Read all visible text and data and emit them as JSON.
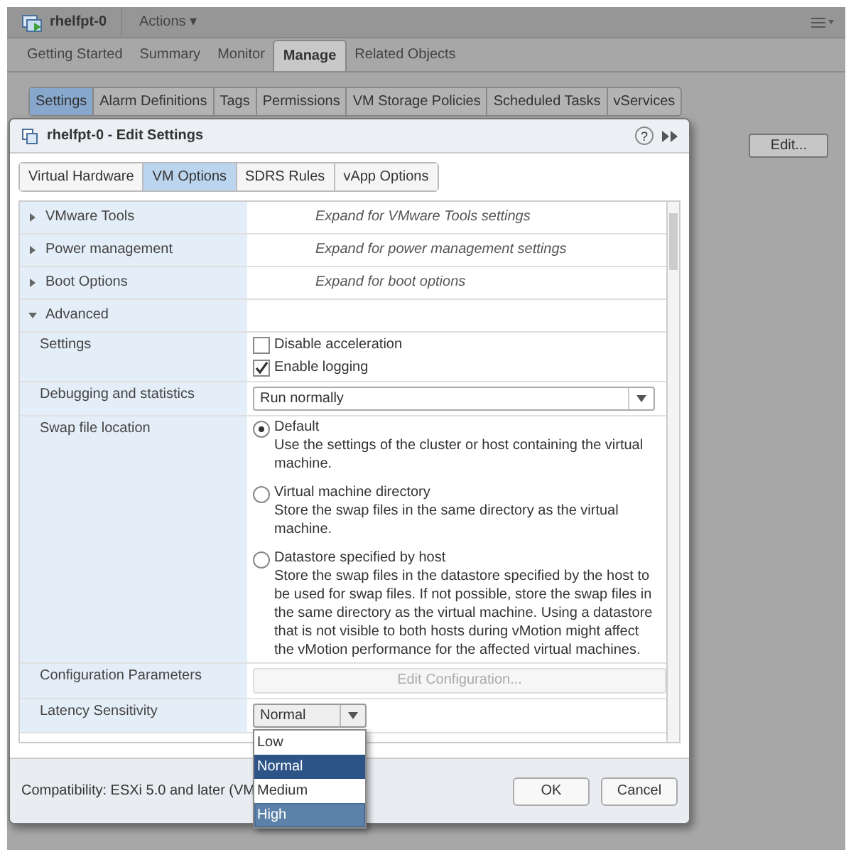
{
  "header": {
    "title": "rhelfpt-0",
    "actions": "Actions ▾"
  },
  "tabs": [
    {
      "label": "Getting Started",
      "selected": false
    },
    {
      "label": "Summary",
      "selected": false
    },
    {
      "label": "Monitor",
      "selected": false
    },
    {
      "label": "Manage",
      "selected": true
    },
    {
      "label": "Related Objects",
      "selected": false
    }
  ],
  "subtabs": [
    {
      "label": "Settings",
      "selected": true
    },
    {
      "label": "Alarm Definitions",
      "selected": false
    },
    {
      "label": "Tags",
      "selected": false
    },
    {
      "label": "Permissions",
      "selected": false
    },
    {
      "label": "VM Storage Policies",
      "selected": false
    },
    {
      "label": "Scheduled Tasks",
      "selected": false
    },
    {
      "label": "vServices",
      "selected": false
    }
  ],
  "edit_button": "Edit...",
  "dialog": {
    "title": "rhelfpt-0 - Edit Settings",
    "help": "?",
    "tabs": [
      {
        "label": "Virtual Hardware",
        "selected": false
      },
      {
        "label": "VM Options",
        "selected": true
      },
      {
        "label": "SDRS Rules",
        "selected": false
      },
      {
        "label": "vApp Options",
        "selected": false
      }
    ],
    "rows": [
      {
        "kind": "group",
        "label": "VMware Tools",
        "expanded": false,
        "hint": "Expand for VMware Tools settings"
      },
      {
        "kind": "group",
        "label": "Power management",
        "expanded": false,
        "hint": "Expand for power management settings"
      },
      {
        "kind": "group",
        "label": "Boot Options",
        "expanded": false,
        "hint": "Expand for boot options"
      },
      {
        "kind": "group",
        "label": "Advanced",
        "expanded": true
      },
      {
        "kind": "checkboxes",
        "label": "Settings",
        "options": [
          {
            "label": "Disable acceleration",
            "checked": false
          },
          {
            "label": "Enable logging",
            "checked": true
          }
        ]
      },
      {
        "kind": "select",
        "label": "Debugging and statistics",
        "value": "Run normally"
      },
      {
        "kind": "radios",
        "label": "Swap file location",
        "options": [
          {
            "label": "Default",
            "selected": true,
            "description": "Use the settings of the cluster or host containing the virtual machine."
          },
          {
            "label": "Virtual machine directory",
            "selected": false,
            "description": "Store the swap files in the same directory as the virtual machine."
          },
          {
            "label": "Datastore specified by host",
            "selected": false,
            "description": "Store the swap files in the datastore specified by the host to be used for swap files. If not possible, store the swap files in the same directory as the virtual machine. Using a datastore that is not visible to both hosts during vMotion might affect the vMotion performance for the affected virtual machines."
          }
        ]
      },
      {
        "kind": "button",
        "label": "Configuration Parameters",
        "button": "Edit Configuration...",
        "disabled": true
      },
      {
        "kind": "dropdown",
        "label": "Latency Sensitivity",
        "value": "Normal",
        "open": true,
        "options": [
          {
            "label": "Low",
            "selected": false,
            "highlighted": false
          },
          {
            "label": "Normal",
            "selected": true,
            "highlighted": false
          },
          {
            "label": "Medium",
            "selected": false,
            "highlighted": false
          },
          {
            "label": "High",
            "selected": false,
            "highlighted": true
          }
        ]
      }
    ],
    "compatibility": "Compatibility: ESXi 5.0 and later (VM",
    "buttons": [
      "OK",
      "Cancel"
    ]
  }
}
